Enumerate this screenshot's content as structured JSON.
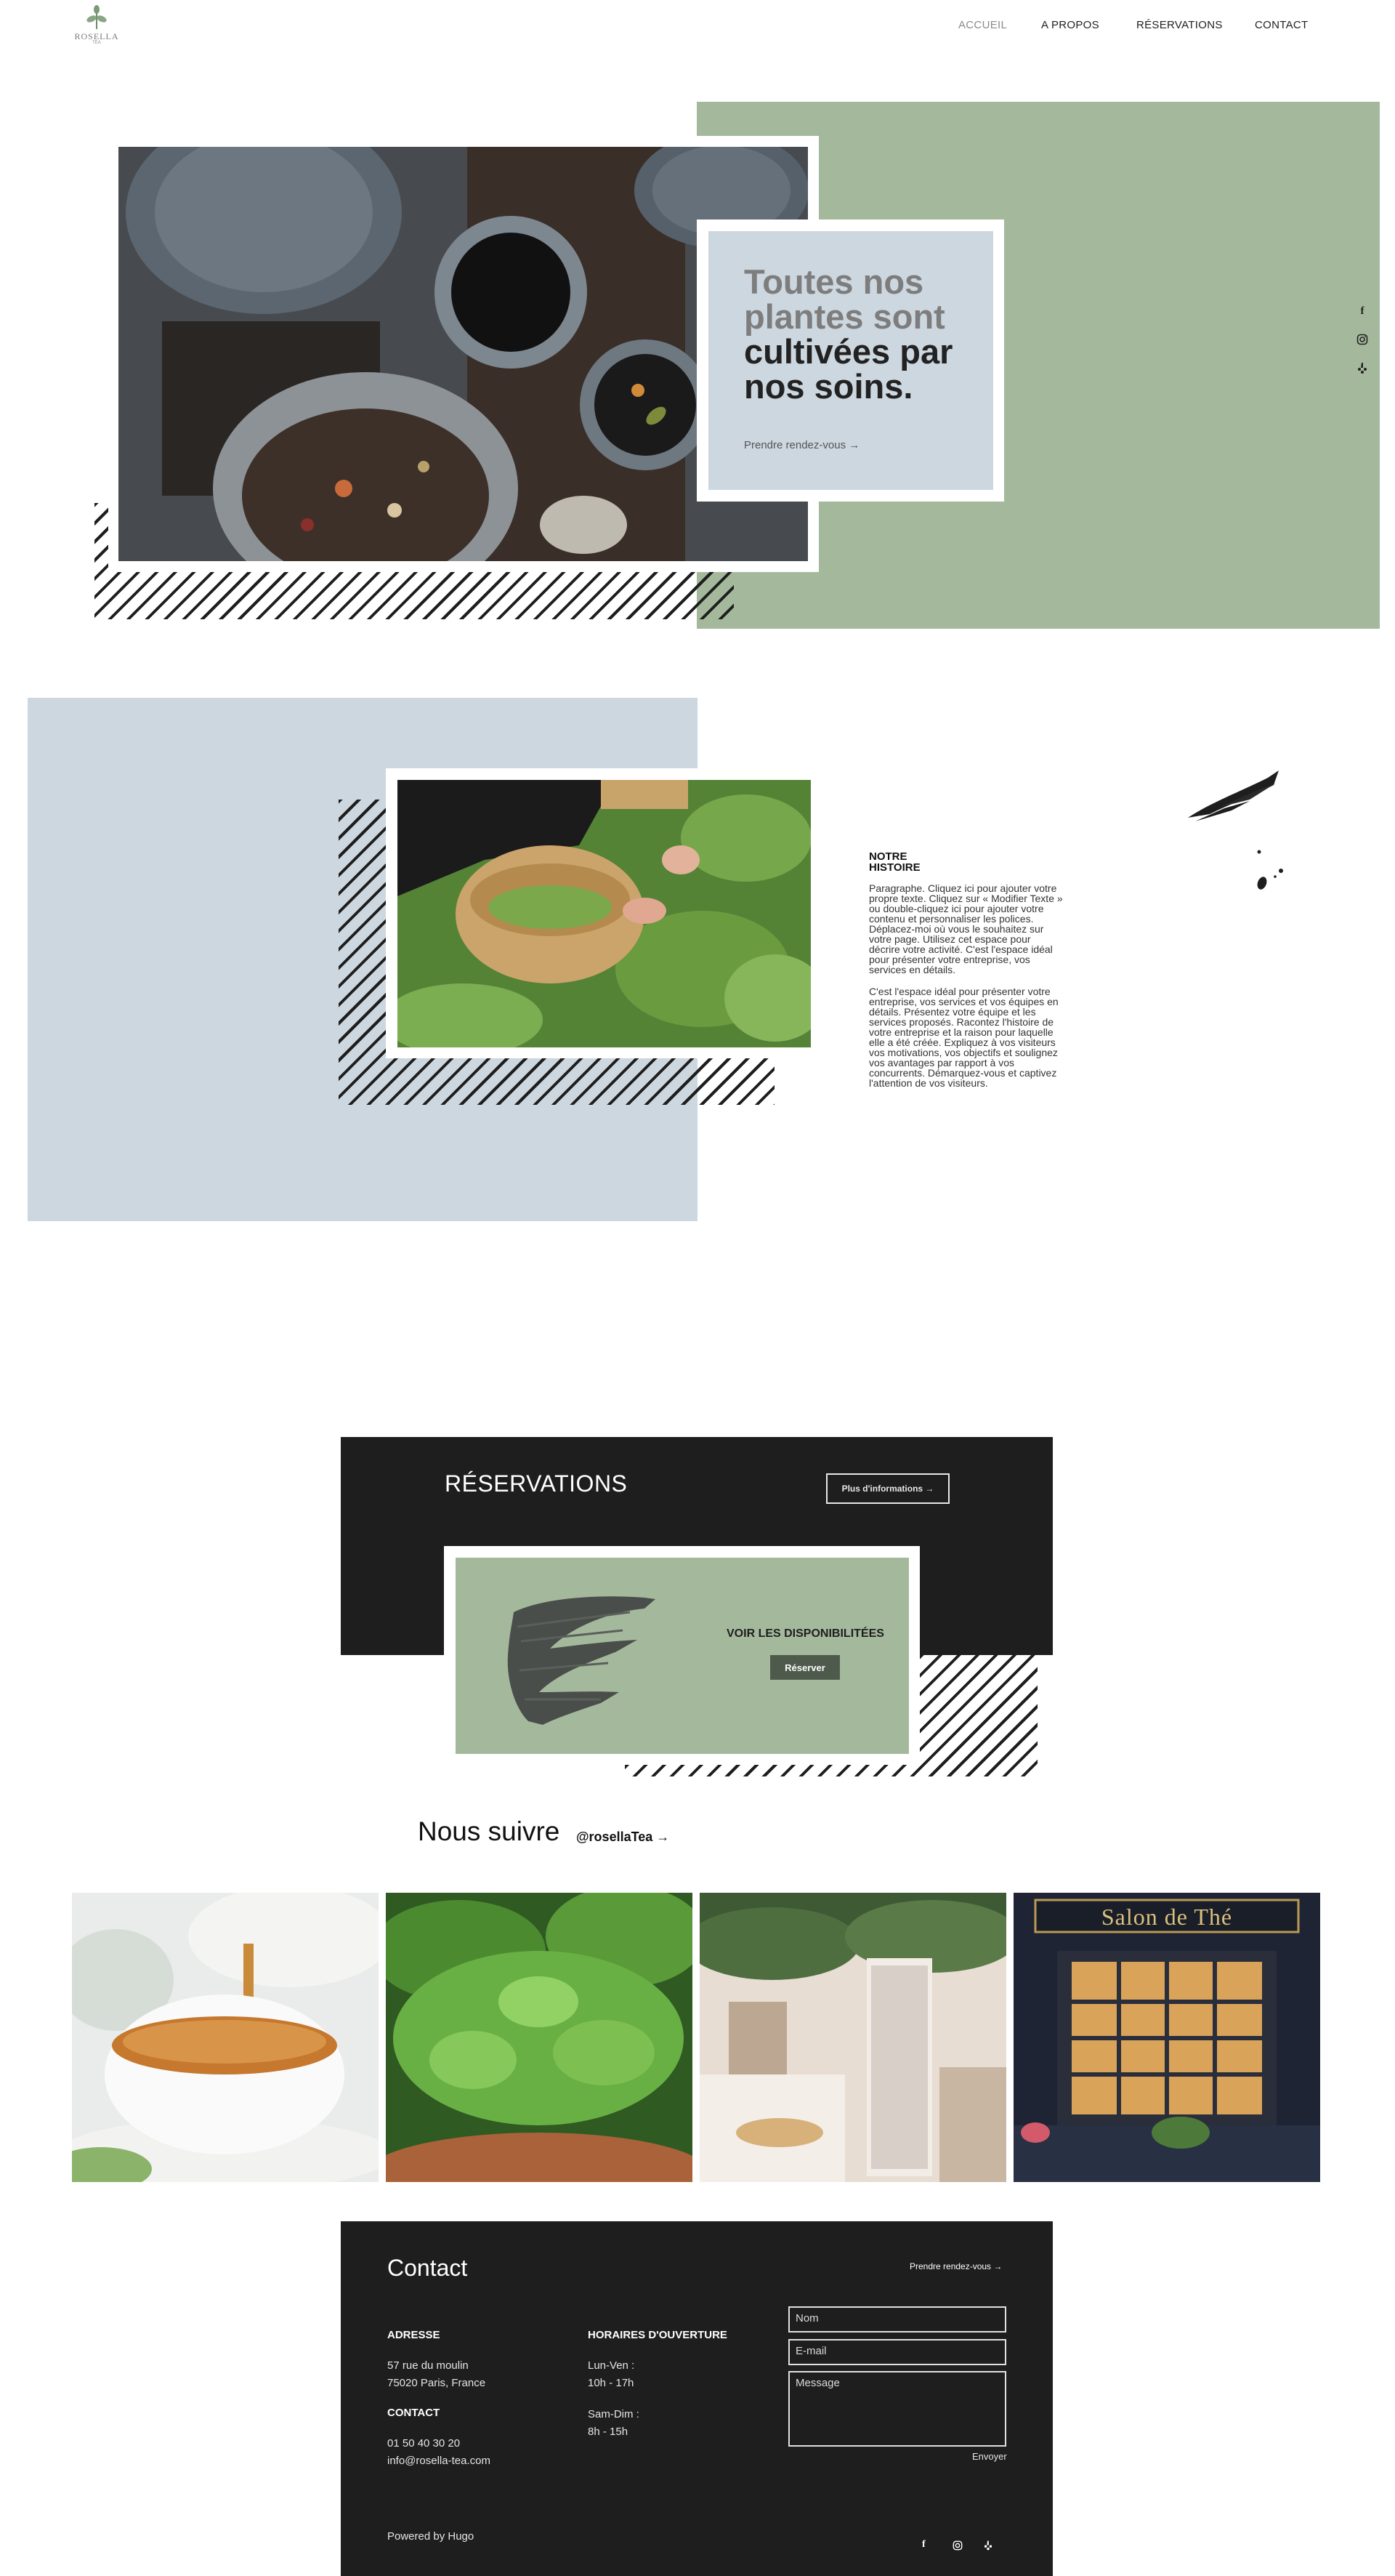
{
  "header": {
    "logo_text": "ROSELLA",
    "logo_sub": "TEA",
    "nav": [
      {
        "label": "ACCUEIL",
        "active": true
      },
      {
        "label": "A PROPOS",
        "active": false
      },
      {
        "label": "RÉSERVATIONS",
        "active": false
      },
      {
        "label": "CONTACT",
        "active": false
      }
    ]
  },
  "hero": {
    "title_gray_1": "Toutes nos",
    "title_gray_2": "plantes sont",
    "title_dark_1": "cultivées par",
    "title_dark_2": "nos soins.",
    "cta": "Prendre rendez-vous →"
  },
  "social_icons": [
    "facebook-icon",
    "instagram-icon",
    "yelp-icon"
  ],
  "story": {
    "heading_1": "NOTRE",
    "heading_2": "HISTOIRE",
    "p1_lines": [
      "Paragraphe. Cliquez ici pour ajouter votre",
      "propre texte. Cliquez sur « Modifier Texte »",
      "ou double-cliquez ici pour ajouter votre",
      "contenu et personnaliser les polices.",
      "Déplacez-moi où vous le souhaitez sur",
      "votre page. Utilisez cet espace pour",
      "décrire votre activité. C'est l'espace idéal",
      "pour présenter votre entreprise, vos",
      "services en détails."
    ],
    "p2_lines": [
      "C'est l'espace idéal pour présenter votre",
      "entreprise, vos services et vos équipes en",
      "détails. Présentez votre équipe et les",
      "services proposés. Racontez l'histoire de",
      "votre entreprise et la raison pour laquelle",
      "elle a été créée. Expliquez à vos visiteurs",
      "vos motivations, vos objectifs et soulignez",
      "vos avantages par rapport à vos",
      "concurrents. Démarquez-vous et captivez",
      "l'attention de vos visiteurs."
    ]
  },
  "reservations": {
    "title": "RÉSERVATIONS",
    "more_info": "Plus d'informations →",
    "availability": "VOIR LES DISPONIBILITÉES",
    "book": "Réserver"
  },
  "follow": {
    "title": "Nous suivre",
    "handle": "@rosellaTea →"
  },
  "gallery": {
    "shop_sign": "Salon de Thé"
  },
  "contact": {
    "title": "Contact",
    "cta": "Prendre rendez-vous →",
    "address_h": "ADRESSE",
    "address_1": "57 rue du moulin",
    "address_2": "75020 Paris, France",
    "contact_h": "CONTACT",
    "phone": "01 50 40 30 20",
    "email": "info@rosella-tea.com",
    "hours_h": "HORAIRES D'OUVERTURE",
    "hours_1": "Lun-Ven :",
    "hours_2": "10h - 17h",
    "hours_3": "Sam-Dim :",
    "hours_4": "8h - 15h",
    "form": {
      "name": "Nom",
      "email": "E-mail",
      "message": "Message",
      "submit": "Envoyer"
    },
    "powered": "Powered by Hugo"
  },
  "colors": {
    "sage": "#a4b99c",
    "pale_blue": "#cdd7df",
    "dark": "#1e1e1e",
    "button_dark": "#4e5a4c"
  }
}
